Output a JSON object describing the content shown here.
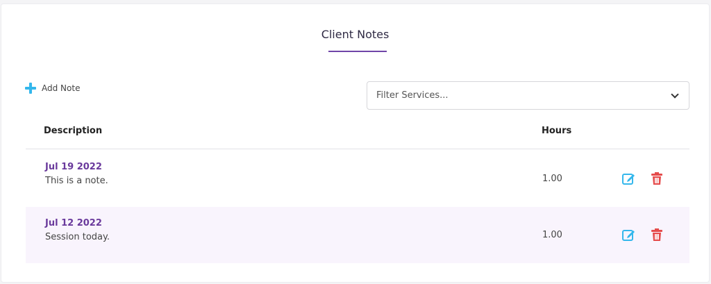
{
  "card": {
    "title": "Client Notes"
  },
  "toolbar": {
    "add_note_label": "Add Note",
    "filter_placeholder": "Filter Services..."
  },
  "table": {
    "columns": [
      "Description",
      "Hours"
    ],
    "rows": [
      {
        "date": "Jul 19 2022",
        "description": "This is a note.",
        "hours": "1.00"
      },
      {
        "date": "Jul 12 2022",
        "description": "Session today.",
        "hours": "1.00"
      }
    ]
  },
  "icons": {
    "add": "plus-icon",
    "dropdown": "chevron-down-icon",
    "edit": "edit-icon",
    "delete": "trash-icon"
  },
  "colors": {
    "accent_purple": "#6f45a8",
    "date_purple": "#6a3a9c",
    "edit_blue": "#34b7ec",
    "delete_red": "#e54b4b",
    "alt_row": "#f9f4fd"
  }
}
